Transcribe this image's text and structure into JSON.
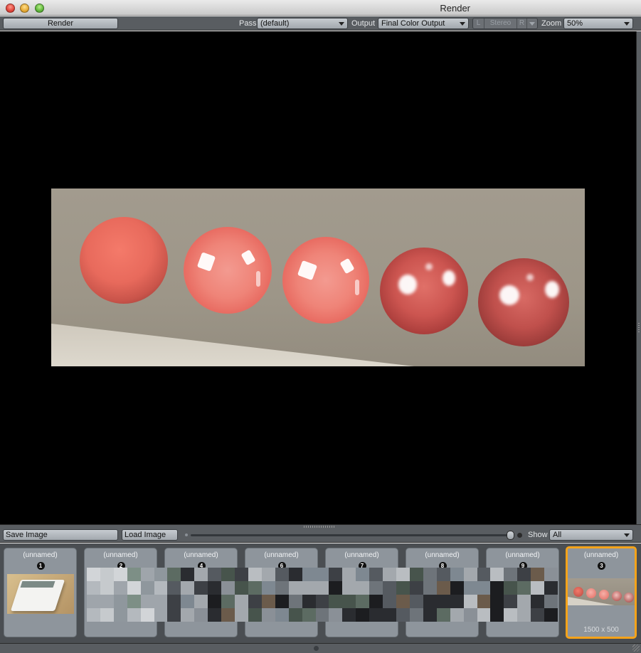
{
  "window": {
    "title": "Render"
  },
  "toolbar": {
    "render_label": "Render",
    "pass_label": "Pass",
    "pass_value": "(default)",
    "output_label": "Output",
    "output_value": "Final Color Output",
    "stereo_left": "L",
    "stereo_label": "Stereo",
    "stereo_right": "R",
    "zoom_label": "Zoom",
    "zoom_value": "50%"
  },
  "bottom_bar": {
    "save_label": "Save Image",
    "load_label": "Load Image",
    "show_label": "Show",
    "show_value": "All"
  },
  "history": [
    {
      "name": "(unnamed)",
      "number": "1",
      "preview": "calculator"
    },
    {
      "name": "(unnamed)",
      "number": "2",
      "preview": "pixelated"
    },
    {
      "name": "(unnamed)",
      "number": "4",
      "preview": "pixelated"
    },
    {
      "name": "(unnamed)",
      "number": "6",
      "preview": "pixelated"
    },
    {
      "name": "(unnamed)",
      "number": "7",
      "preview": "pixelated"
    },
    {
      "name": "(unnamed)",
      "number": "8",
      "preview": "pixelated"
    },
    {
      "name": "(unnamed)",
      "number": "9",
      "preview": "pixelated"
    },
    {
      "name": "(unnamed)",
      "number": "3",
      "preview": "spheres",
      "size": "1500 x 500",
      "active": true
    }
  ],
  "colors": {
    "accent_selected": "#f5a31a",
    "toolbar_bg": "#595d61",
    "viewport_bg": "#000000"
  }
}
